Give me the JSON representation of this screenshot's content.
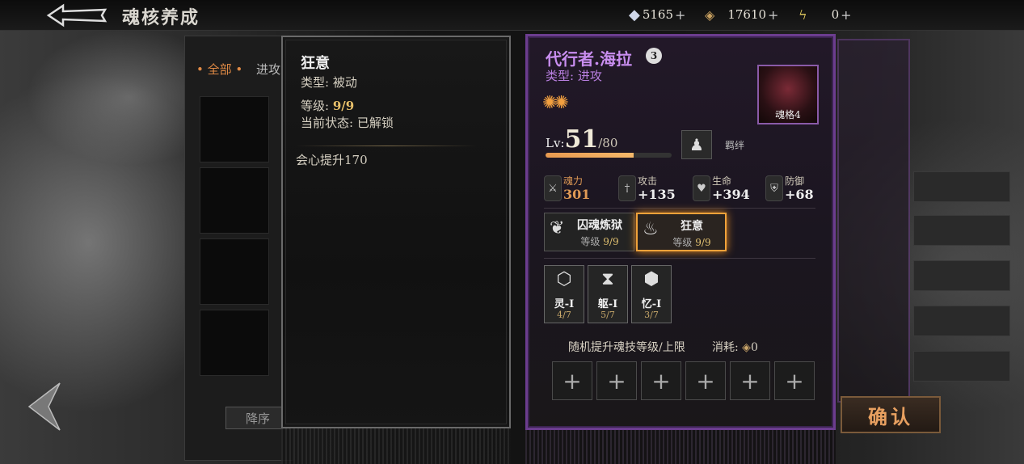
{
  "header": {
    "title": "魂核养成",
    "resources": [
      {
        "icon": "crystal-icon",
        "value": "5165",
        "plus": "+"
      },
      {
        "icon": "coin-icon",
        "value": "17610",
        "plus": "+"
      },
      {
        "icon": "lightning-icon",
        "value": "0",
        "plus": "+"
      }
    ]
  },
  "list": {
    "tabs": [
      "• 全部 •",
      "进攻"
    ],
    "sort_label": "降序"
  },
  "tooltip": {
    "name": "狂意",
    "type": "类型: 被动",
    "level_label": "等级:",
    "level_value": "9/9",
    "status": "当前状态: 已解锁",
    "effect": "会心提升170"
  },
  "card": {
    "name": "代行者.海拉",
    "badge": "3",
    "type": "类型: 进攻",
    "portrait_label": "魂格4",
    "lv_prefix": "Lv:",
    "lv": "51",
    "lv_max": "/80",
    "xp_fraction": 0.7,
    "bond_label": "羁绊",
    "stats": [
      {
        "label": "魂力",
        "value": "301"
      },
      {
        "label": "攻击",
        "value": "+135"
      },
      {
        "label": "生命",
        "value": "+394"
      },
      {
        "label": "防御",
        "value": "+68"
      }
    ],
    "skills": [
      {
        "name": "囚魂炼狱",
        "level_label": "等级",
        "level": "9/9"
      },
      {
        "name": "狂意",
        "level_label": "等级",
        "level": "9/9"
      }
    ],
    "runes": [
      {
        "name": "灵-I",
        "count": "4/7"
      },
      {
        "name": "躯-I",
        "count": "5/7"
      },
      {
        "name": "忆-I",
        "count": "3/7"
      }
    ],
    "upgrade_text": "随机提升魂技等级/上限",
    "cost_label": "消耗:",
    "cost_value": "0",
    "empty_slot_symbol": "+"
  },
  "actions": {
    "confirm_label": "确认"
  }
}
